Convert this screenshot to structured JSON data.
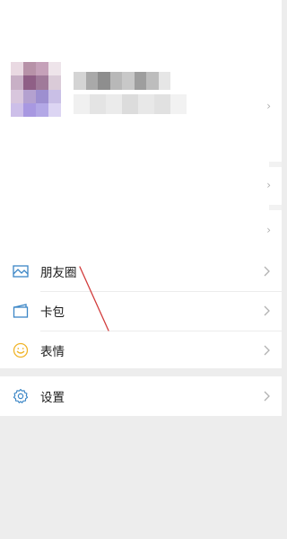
{
  "menu": {
    "moments_label": "朋友圈",
    "cards_label": "卡包",
    "stickers_label": "表情",
    "settings_label": "设置"
  },
  "colors": {
    "icon_blue": "#3b86c6",
    "sticker_yellow": "#f0b429",
    "annotation_red": "#d23c3c",
    "chevron": "#b2b2b2"
  }
}
